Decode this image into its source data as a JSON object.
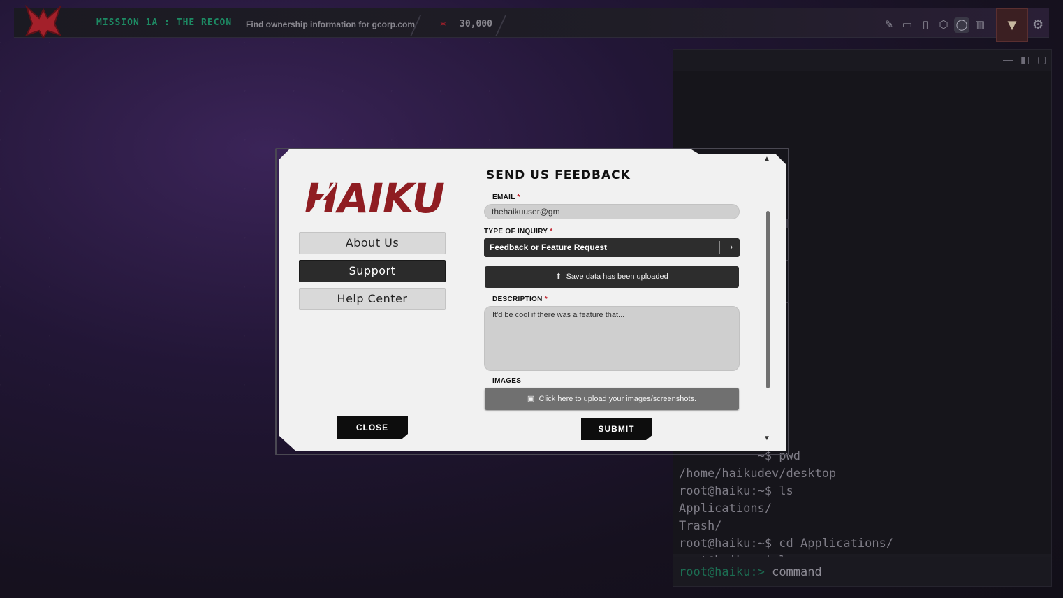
{
  "topbar": {
    "mission": "MISSION 1A : THE RECON",
    "mission_desc": "Find ownership information for gcorp.com",
    "points": "30,000",
    "icons": [
      "edit-icon",
      "folder-icon",
      "book-icon",
      "hexagon-icon",
      "chat-icon",
      "map-icon"
    ]
  },
  "terminal": {
    "lines": [
      "           ~$ pwd",
      "/home/haikudev/desktop",
      "root@haiku:~$ ls",
      "Applications/",
      "Trash/",
      "root@haiku:~$ cd Applications/",
      "root@haiku:~$ ls"
    ],
    "prompt": "root@haiku:>",
    "command": "command"
  },
  "modal": {
    "logo": "HAIKU",
    "nav": {
      "about": "About Us",
      "support": "Support",
      "help": "Help Center"
    },
    "close": "CLOSE",
    "title": "SEND US FEEDBACK",
    "email_label": "EMAIL",
    "email_value": "thehaikuuser@gm",
    "inquiry_label": "TYPE OF INQUIRY",
    "inquiry_value": "Feedback or Feature Request",
    "save_upload": "Save data has been uploaded",
    "description_label": "DESCRIPTION",
    "description_value": "It'd be cool if there was a feature that...",
    "images_label": "IMAGES",
    "images_upload": "Click here to upload your images/screenshots.",
    "submit": "SUBMIT",
    "required_mark": "*"
  }
}
